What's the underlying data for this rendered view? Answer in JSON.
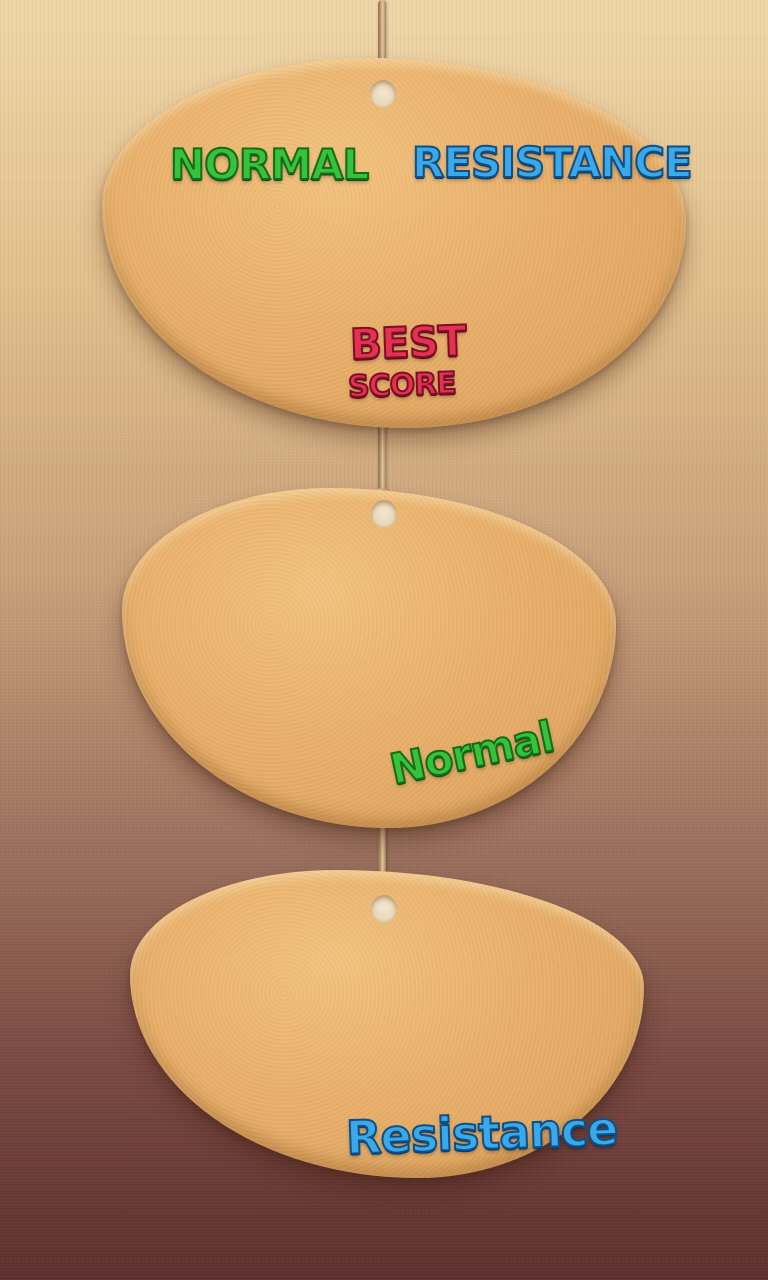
{
  "score_board": {
    "normal_label": "NORMAL",
    "resistance_label": "RESISTANCE",
    "best_label": "BEST",
    "score_label": "SCORE"
  },
  "modes": {
    "normal_button": "Normal",
    "resistance_button": "Resistance"
  },
  "colors": {
    "stone": "#e9b06a",
    "normal_text": "#36c23b",
    "resistance_text": "#3aa9ea",
    "best_score_text": "#e33154"
  }
}
